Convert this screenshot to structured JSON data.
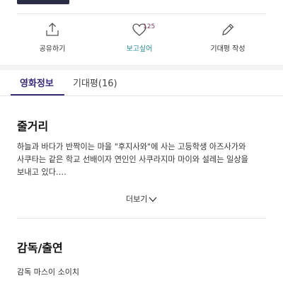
{
  "actions": {
    "share_label": "공유하기",
    "wish_label": "보고싶어",
    "wish_count": "125",
    "review_label": "기대평 작성"
  },
  "tabs": [
    {
      "label": "영화정보",
      "active": true
    },
    {
      "label": "기대평(16)",
      "active": false
    }
  ],
  "synopsis": {
    "title": "줄거리",
    "text": "하늘과 바다가 반짝이는 마을 \"후지사와\"에 사는 고등학생 아즈사가와 사쿠타는 같은 학교 선배이자 연인인 사쿠라지마 마이와 설레는 일상을 보내고 있다.…",
    "more_label": "더보기"
  },
  "cast": {
    "title": "감독/출연",
    "director_line": "감독 마스이 소이치"
  },
  "colors": {
    "accent": "#3b2a78",
    "wish": "#2a8a93",
    "badge": "#7a3e68"
  },
  "icons": [
    "share-icon",
    "heart-icon",
    "pencil-icon",
    "chevron-down-icon"
  ]
}
